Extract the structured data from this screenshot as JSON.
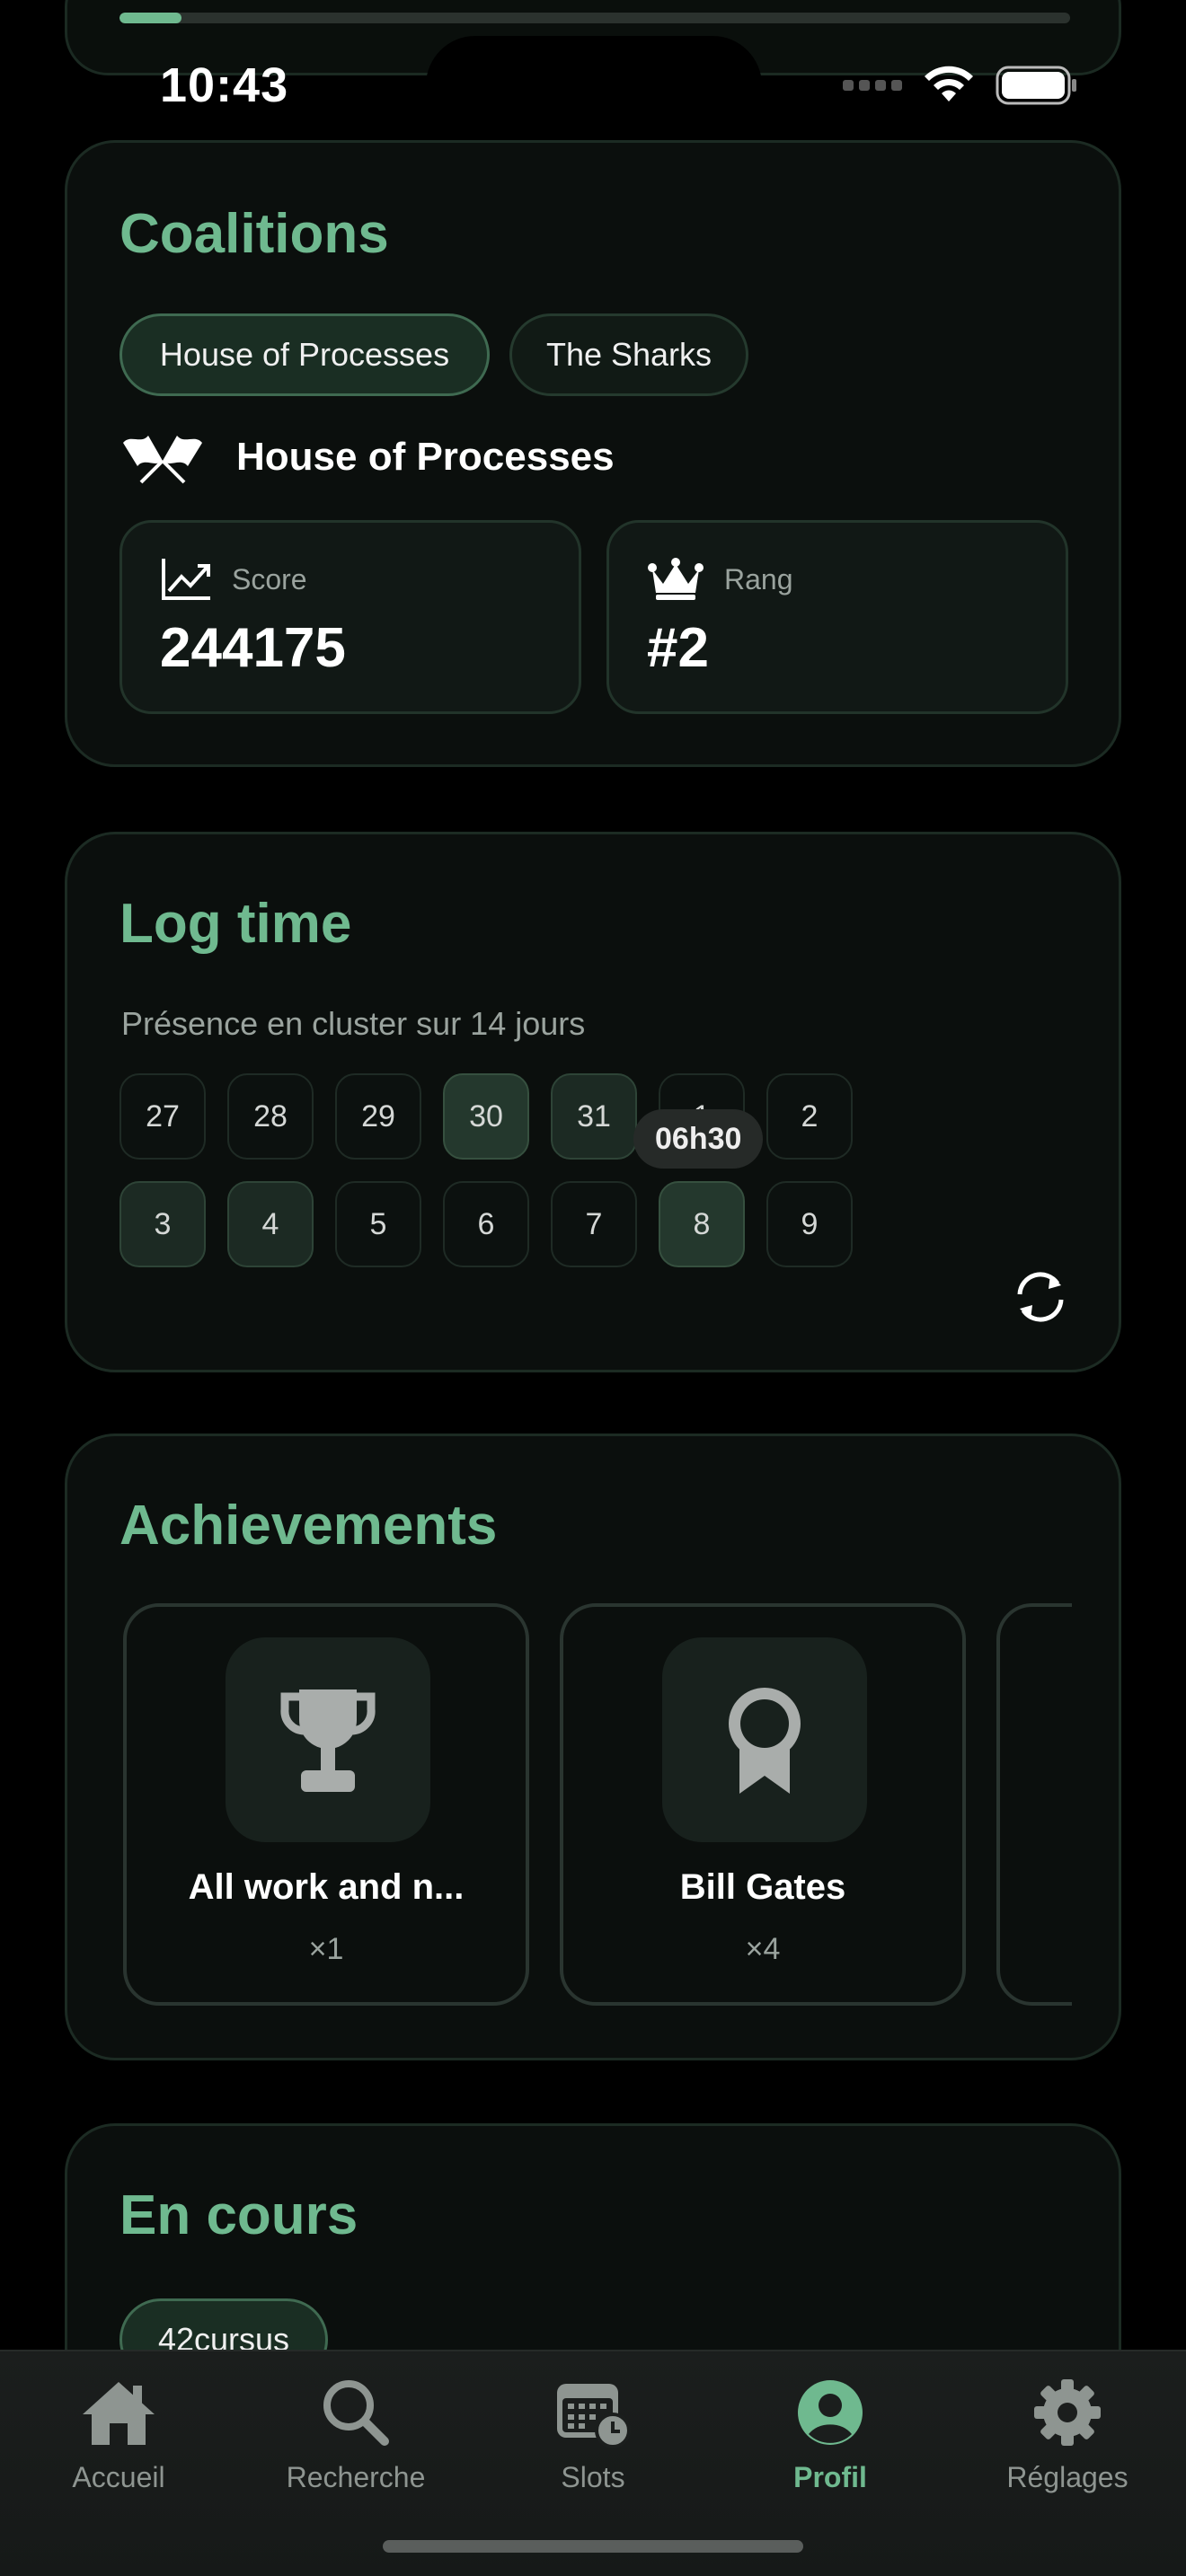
{
  "status_bar": {
    "time": "10:43"
  },
  "top_card": {
    "progress_percent": 6.5
  },
  "coalitions": {
    "title": "Coalitions",
    "tabs": [
      {
        "label": "House of Processes",
        "selected": true
      },
      {
        "label": "The Sharks",
        "selected": false
      }
    ],
    "selected_name": "House of Processes",
    "score": {
      "label": "Score",
      "value": "244175"
    },
    "rank": {
      "label": "Rang",
      "value": "#2"
    }
  },
  "log_time": {
    "title": "Log time",
    "subtitle": "Présence en cluster sur 14 jours",
    "days_row1": [
      "27",
      "28",
      "29",
      "30",
      "31",
      "1",
      "2"
    ],
    "days_row2": [
      "3",
      "4",
      "5",
      "6",
      "7",
      "8",
      "9"
    ],
    "tooltip": "06h30"
  },
  "achievements": {
    "title": "Achievements",
    "items": [
      {
        "name": "All work and n...",
        "count": "×1",
        "icon": "trophy-icon"
      },
      {
        "name": "Bill Gates",
        "count": "×4",
        "icon": "award-ribbon-icon"
      }
    ]
  },
  "en_cours": {
    "title": "En cours",
    "chip": "42cursus"
  },
  "tabbar": {
    "tabs": [
      {
        "label": "Accueil",
        "icon": "house-icon"
      },
      {
        "label": "Recherche",
        "icon": "search-icon"
      },
      {
        "label": "Slots",
        "icon": "calendar-clock-icon"
      },
      {
        "label": "Profil",
        "icon": "person-circle-icon",
        "active": true
      },
      {
        "label": "Réglages",
        "icon": "gear-icon"
      }
    ]
  },
  "colors": {
    "accent": "#6fb98f",
    "background": "#000000",
    "card": "#0b0f0d"
  }
}
